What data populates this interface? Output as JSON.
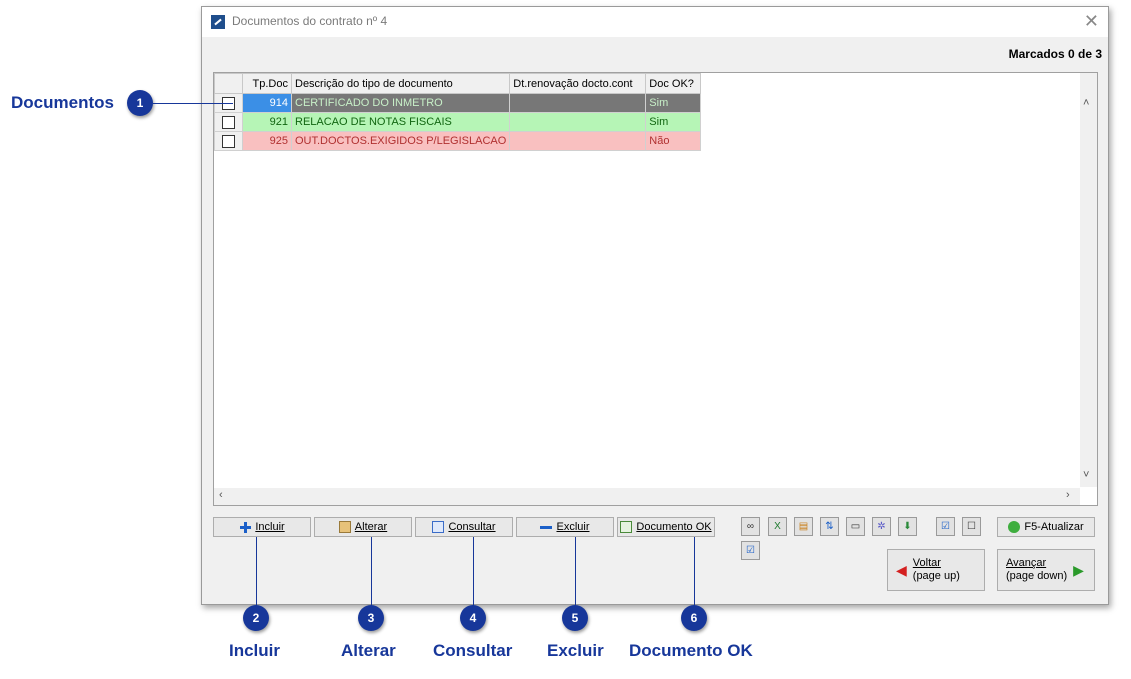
{
  "window": {
    "title": "Documentos do contrato nº 4",
    "close_glyph": "✕",
    "marked_text": "Marcados 0 de 3"
  },
  "grid": {
    "headers": [
      "",
      "Tp.Doc",
      "Descrição do tipo de documento",
      "Dt.renovação docto.cont",
      "Doc OK?"
    ],
    "rows": [
      {
        "code": "914",
        "desc": "CERTIFICADO DO INMETRO",
        "renewal": "",
        "ok": "Sim",
        "status": "selected"
      },
      {
        "code": "921",
        "desc": "RELACAO DE NOTAS FISCAIS",
        "renewal": "",
        "ok": "Sim",
        "status": "ok"
      },
      {
        "code": "925",
        "desc": "OUT.DOCTOS.EXIGIDOS P/LEGISLACAO",
        "renewal": "",
        "ok": "Não",
        "status": "not-ok"
      }
    ]
  },
  "buttons": {
    "incluir": "Incluir",
    "alterar": "Alterar",
    "consultar": "Consultar",
    "excluir": "Excluir",
    "documento_ok": "Documento OK",
    "f5": "F5-Atualizar",
    "voltar_line1": "Voltar",
    "voltar_line2": "(page up)",
    "avancar_line1": "Avançar",
    "avancar_line2": "(page down)"
  },
  "toolbar_icons": [
    "link-icon",
    "excel-icon",
    "folder-icon",
    "sort-icon",
    "print-icon",
    "settings-icon",
    "export-icon",
    "check-all-icon",
    "uncheck-all-icon",
    "checklist-icon"
  ],
  "callouts": {
    "c1": {
      "num": "1",
      "label": "Documentos"
    },
    "c2": {
      "num": "2",
      "label": "Incluir"
    },
    "c3": {
      "num": "3",
      "label": "Alterar"
    },
    "c4": {
      "num": "4",
      "label": "Consultar"
    },
    "c5": {
      "num": "5",
      "label": "Excluir"
    },
    "c6": {
      "num": "6",
      "label": "Documento OK"
    }
  },
  "colors": {
    "callout": "#17379a",
    "row_selected": "#777777",
    "row_ok": "#b6f5b6",
    "row_not_ok": "#f9c0c0"
  }
}
